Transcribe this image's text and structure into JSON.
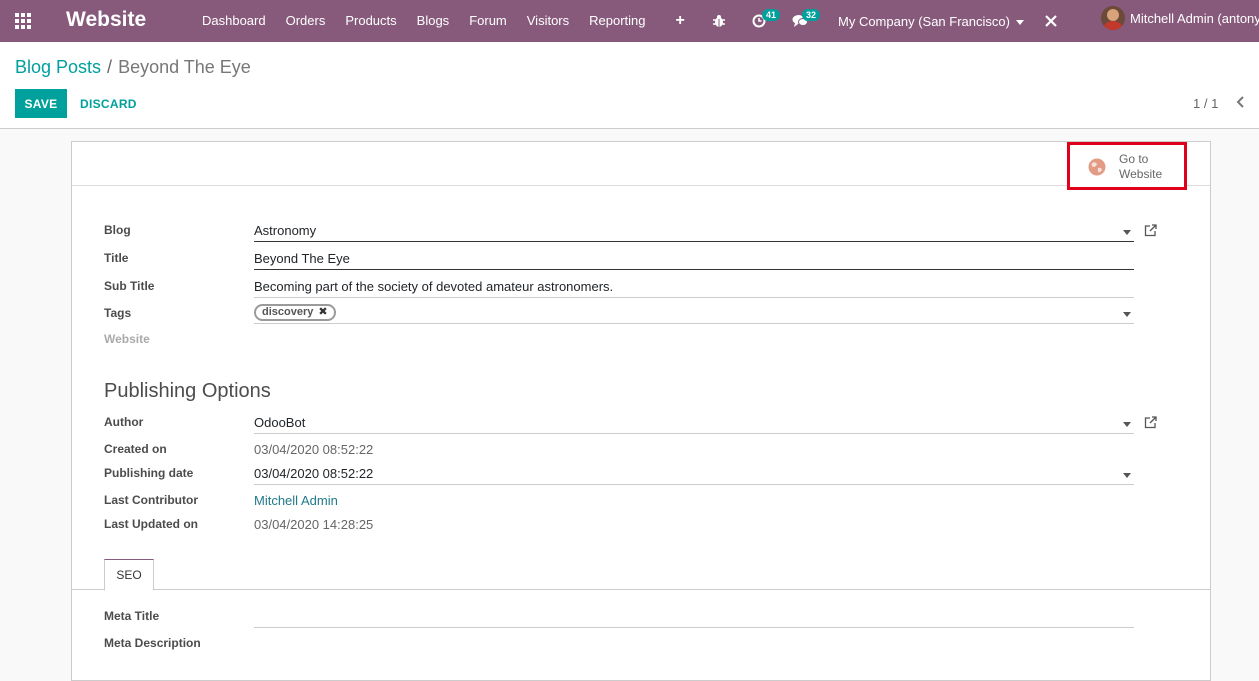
{
  "navbar": {
    "app_name": "Website",
    "menu": [
      "Dashboard",
      "Orders",
      "Products",
      "Blogs",
      "Forum",
      "Visitors",
      "Reporting"
    ],
    "plus": "+",
    "activity_count": "41",
    "message_count": "32",
    "company": "My Company (San Francisco)",
    "user": "Mitchell Admin (antony"
  },
  "breadcrumb": {
    "parent": "Blog Posts",
    "separator": "/",
    "current": "Beyond The Eye"
  },
  "actions": {
    "save": "SAVE",
    "discard": "DISCARD"
  },
  "pager": "1 / 1",
  "button_box": {
    "goto_line1": "Go to",
    "goto_line2": "Website"
  },
  "form": {
    "blog_label": "Blog",
    "blog_value": "Astronomy",
    "title_label": "Title",
    "title_value": "Beyond The Eye",
    "subtitle_label": "Sub Title",
    "subtitle_value": "Becoming part of the society of devoted amateur astronomers.",
    "tags_label": "Tags",
    "tag": "discovery",
    "website_label": "Website"
  },
  "publishing": {
    "heading": "Publishing Options",
    "author_label": "Author",
    "author_value": "OdooBot",
    "created_label": "Created on",
    "created_value": "03/04/2020 08:52:22",
    "pubdate_label": "Publishing date",
    "pubdate_value": "03/04/2020 08:52:22",
    "contributor_label": "Last Contributor",
    "contributor_value": "Mitchell Admin",
    "updated_label": "Last Updated on",
    "updated_value": "03/04/2020 14:28:25"
  },
  "tabs": [
    "SEO"
  ],
  "seo": {
    "meta_title_label": "Meta Title",
    "meta_description_label": "Meta Description"
  },
  "colors": {
    "navbar": "#875a7b",
    "primary": "#00a09d",
    "highlight_border": "#e0001b"
  }
}
